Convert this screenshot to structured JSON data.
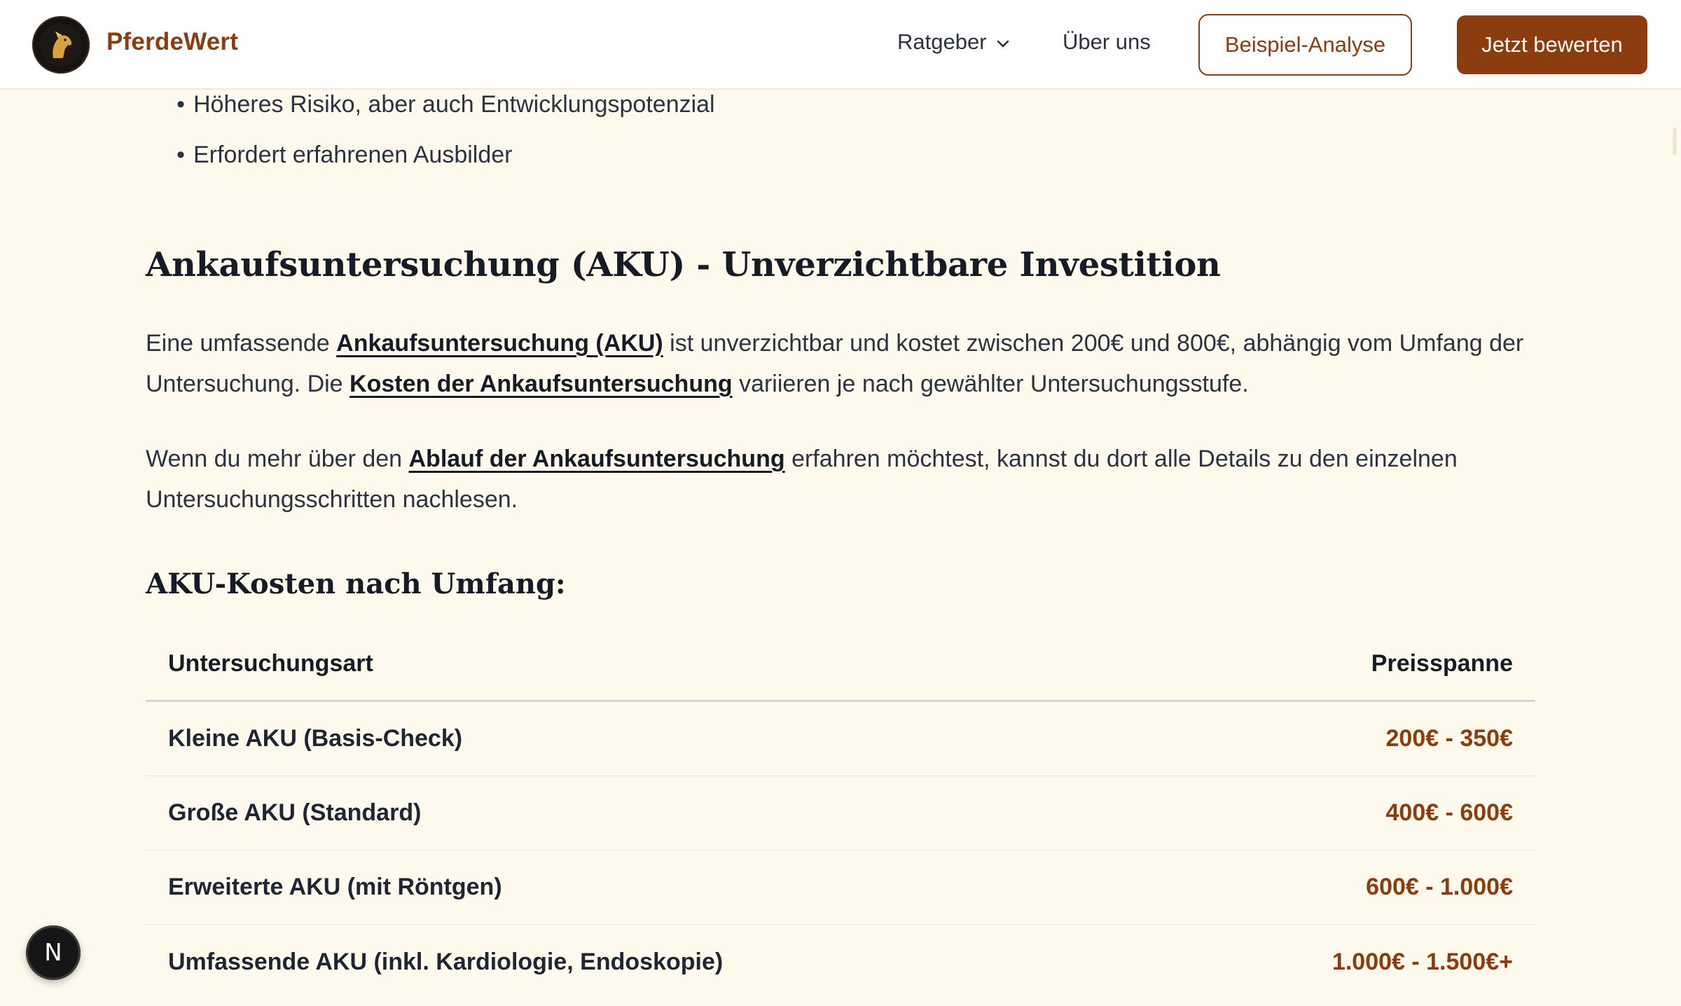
{
  "header": {
    "brand": "PferdeWert",
    "nav": {
      "ratgeber": "Ratgeber",
      "ueber_uns": "Über uns"
    },
    "buttons": {
      "beispiel": "Beispiel-Analyse",
      "bewerten": "Jetzt bewerten"
    }
  },
  "bullets": [
    "Höheres Risiko, aber auch Entwicklungspotenzial",
    "Erfordert erfahrenen Ausbilder"
  ],
  "section": {
    "title": "Ankaufsuntersuchung (AKU) - Unverzichtbare Investition",
    "p1": {
      "t1": "Eine umfassende ",
      "link1": "Ankaufsuntersuchung (AKU)",
      "t2": " ist unverzichtbar und kostet zwischen 200€ und 800€, abhängig vom Umfang der Untersuchung. Die ",
      "link2": "Kosten der Ankaufsuntersuchung",
      "t3": " variieren je nach gewählter Untersuchungsstufe."
    },
    "p2": {
      "t1": "Wenn du mehr über den ",
      "link": "Ablauf der Ankaufsuntersuchung",
      "t2": " erfahren möchtest, kannst du dort alle Details zu den einzelnen Untersuchungsschritten nachlesen."
    },
    "subtitle": "AKU-Kosten nach Umfang:"
  },
  "table": {
    "headers": {
      "type": "Untersuchungsart",
      "price": "Preisspanne"
    },
    "rows": [
      {
        "type": "Kleine AKU (Basis-Check)",
        "price": "200€ - 350€"
      },
      {
        "type": "Große AKU (Standard)",
        "price": "400€ - 600€"
      },
      {
        "type": "Erweiterte AKU (mit Röntgen)",
        "price": "600€ - 1.000€"
      },
      {
        "type": "Umfassende AKU (inkl. Kardiologie, Endoskopie)",
        "price": "1.000€ - 1.500€+"
      }
    ]
  },
  "badge": "N",
  "icons": {
    "logo": "horse-logo-icon",
    "chevron": "chevron-down-icon"
  },
  "colors": {
    "brand": "#8b3d0f",
    "background": "#fdf9ec",
    "text": "#2b3343"
  }
}
